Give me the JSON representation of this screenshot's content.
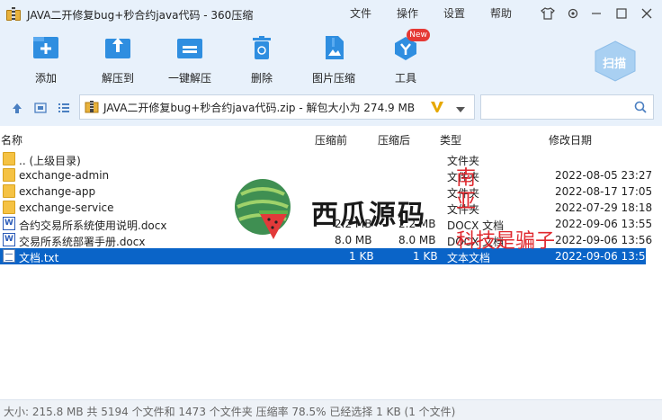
{
  "window": {
    "title": "JAVA二开修复bug+秒合约java代码 - 360压缩",
    "menu": [
      "文件",
      "操作",
      "设置",
      "帮助"
    ]
  },
  "toolbar": {
    "items": [
      {
        "label": "添加",
        "icon": "add-icon"
      },
      {
        "label": "解压到",
        "icon": "extract-to-icon"
      },
      {
        "label": "一键解压",
        "icon": "one-click-extract-icon"
      },
      {
        "label": "删除",
        "icon": "trash-icon"
      },
      {
        "label": "图片压缩",
        "icon": "image-compress-icon"
      },
      {
        "label": "工具",
        "icon": "tools-icon"
      }
    ],
    "new_badge": "New",
    "scan_label": "扫描"
  },
  "address": {
    "path": "JAVA二开修复bug+秒合约java代码.zip - 解包大小为 274.9 MB"
  },
  "columns": {
    "name": "名称",
    "before": "压缩前",
    "after": "压缩后",
    "type": "类型",
    "modified": "修改日期"
  },
  "files": [
    {
      "name": ".. (上级目录)",
      "before": "",
      "after": "",
      "type": "文件夹",
      "date": "",
      "kind": "folder"
    },
    {
      "name": "exchange-admin",
      "before": "",
      "after": "",
      "type": "文件夹",
      "date": "2022-08-05 23:27",
      "kind": "folder"
    },
    {
      "name": "exchange-app",
      "before": "",
      "after": "",
      "type": "文件夹",
      "date": "2022-08-17 17:05",
      "kind": "folder"
    },
    {
      "name": "exchange-service",
      "before": "",
      "after": "",
      "type": "文件夹",
      "date": "2022-07-29 18:18",
      "kind": "folder"
    },
    {
      "name": "合约交易所系统使用说明.docx",
      "before": "2.2 MB",
      "after": "2.2 MB",
      "type": "DOCX 文档",
      "date": "2022-09-06 13:55",
      "kind": "docx"
    },
    {
      "name": "交易所系统部署手册.docx",
      "before": "8.0 MB",
      "after": "8.0 MB",
      "type": "DOCX 文档",
      "date": "2022-09-06 13:56",
      "kind": "docx"
    },
    {
      "name": "文档.txt",
      "before": "1 KB",
      "after": "1 KB",
      "type": "文本文档",
      "date": "2022-09-06 13:55",
      "kind": "txt",
      "selected": true
    }
  ],
  "watermark": {
    "brand": "西瓜源码",
    "red_lines": [
      "南",
      "亚",
      "科技是骗子"
    ]
  },
  "status": {
    "text": "大小: 215.8 MB 共 5194 个文件和 1473 个文件夹 压缩率 78.5% 已经选择 1 KB (1 个文件)"
  }
}
